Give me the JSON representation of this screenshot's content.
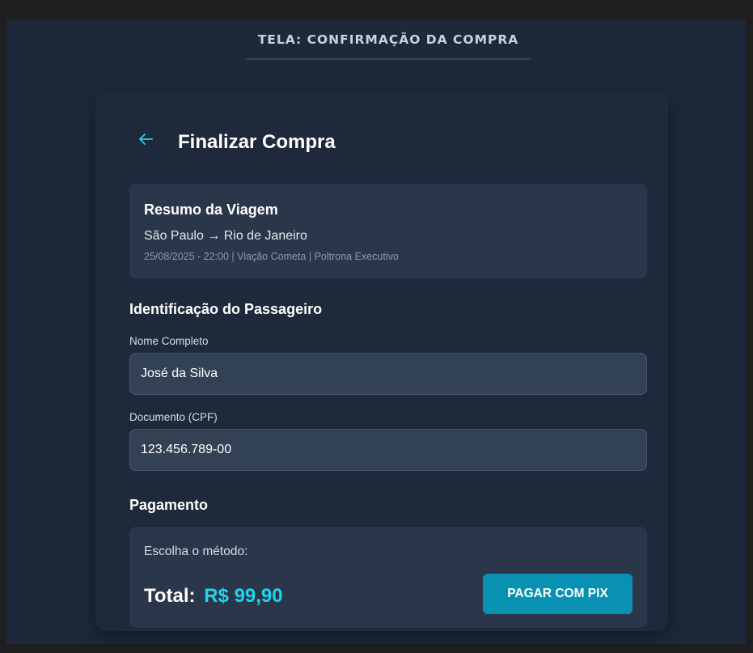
{
  "screen": {
    "title": "TELA: CONFIRMAÇÃO DA COMPRA"
  },
  "header": {
    "back_icon": "arrow-left-icon",
    "title": "Finalizar Compra"
  },
  "trip_summary": {
    "heading": "Resumo da Viagem",
    "route": "São Paulo → Rio de Janeiro",
    "details": "25/08/2025 - 22:00 | Viação Cometa | Poltrona Executivo"
  },
  "passenger": {
    "section_title": "Identificação do Passageiro",
    "name_label": "Nome Completo",
    "name_value": "José da Silva",
    "document_label": "Documento (CPF)",
    "document_value": "123.456.789-00"
  },
  "payment": {
    "section_title": "Pagamento",
    "method_label": "Escolha o método:",
    "total_label": "Total:",
    "total_value": "R$ 99,90",
    "pay_button": "PAGAR COM PIX"
  },
  "colors": {
    "background": "#1d283a",
    "card": "#1e293b",
    "panel": "#2a3649",
    "accent": "#22d3ee",
    "button": "#0891b2"
  }
}
